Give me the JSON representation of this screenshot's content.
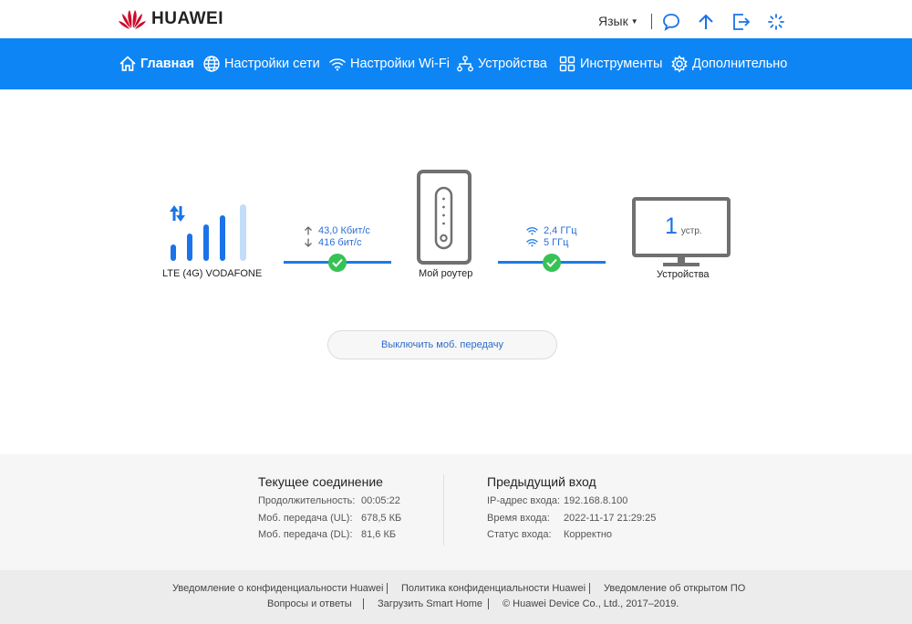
{
  "brand": {
    "name": "HUAWEI",
    "color": "#cf0a2c"
  },
  "topbar": {
    "language_label": "Язык",
    "icons": [
      "chat-icon",
      "upload-icon",
      "logout-icon",
      "loading-icon"
    ]
  },
  "nav": {
    "accent": "#0d85f5",
    "items": [
      {
        "label": "Главная",
        "icon": "home-icon",
        "active": true
      },
      {
        "label": "Настройки сети",
        "icon": "globe-icon"
      },
      {
        "label": "Настройки Wi-Fi",
        "icon": "wifi-icon"
      },
      {
        "label": "Устройства",
        "icon": "devices-icon"
      },
      {
        "label": "Инструменты",
        "icon": "tools-icon"
      },
      {
        "label": "Дополнительно",
        "icon": "gear-icon"
      }
    ]
  },
  "topology": {
    "network_label": "LTE (4G) VODAFONE",
    "upload_rate": "43,0 Кбит/с",
    "download_rate": "416 бит/с",
    "router_label": "Мой роутер",
    "band_24": "2,4 ГГц",
    "band_5": "5 ГГц",
    "device_count": "1",
    "device_unit": "устр.",
    "devices_label": "Устройства",
    "status_ok_color": "#37c255"
  },
  "actions": {
    "disable_mobile_data": "Выключить моб. передачу"
  },
  "current_connection": {
    "title": "Текущее соединение",
    "rows": [
      {
        "key": "Продолжительность:",
        "value": "00:05:22"
      },
      {
        "key": "Моб. передача (UL):",
        "value": "678,5 КБ"
      },
      {
        "key": "Моб. передача (DL):",
        "value": "81,6 КБ"
      }
    ]
  },
  "previous_login": {
    "title": "Предыдущий вход",
    "rows": [
      {
        "key": "IP-адрес входа:",
        "value": "192.168.8.100"
      },
      {
        "key": "Время входа:",
        "value": "2022-11-17 21:29:25"
      },
      {
        "key": "Статус входа:",
        "value": "Корректно"
      }
    ]
  },
  "footer": {
    "privacy_notice": "Уведомление о конфиденциальности Huawei",
    "privacy_policy": "Политика конфиденциальности Huawei",
    "open_source": "Уведомление об открытом ПО",
    "faq": "Вопросы и ответы",
    "smart_home": "Загрузить Smart Home",
    "copyright": "© Huawei Device Co., Ltd., 2017–2019."
  }
}
